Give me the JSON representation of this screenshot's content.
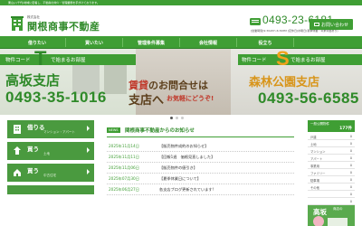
{
  "topbar": {
    "text": "栗山(八千代)地域に密着し、不動産の仲介・管理業務を手がけております。"
  },
  "header": {
    "logo_small": "株式会社",
    "company_name": "関根商事不動産",
    "phone": "0493-23-6181",
    "info": "[営業時間]9:30AM〜6:30PM [定休日]水曜日(夏季休業・年末年始あり)",
    "contact_label": "お問い合わせ"
  },
  "nav": {
    "items": [
      {
        "label": "借りたい"
      },
      {
        "label": "買いたい"
      },
      {
        "label": "管理条件募集"
      },
      {
        "label": "会社情報"
      },
      {
        "label": "役立ち"
      },
      {
        "label": ""
      }
    ]
  },
  "slider": {
    "left": {
      "code_prefix": "物件コード",
      "code_letter": "T",
      "code_suffix": "で始まるお部屋",
      "shop": "高坂支店",
      "phone": "0493-35-1016"
    },
    "center": {
      "line1_red": "賃貸",
      "line1": "のお問合せは",
      "line2": "支店へ",
      "line2_small": "お気軽にどうぞ!"
    },
    "right": {
      "code_prefix": "物件コード",
      "code_letter": "S",
      "code_suffix": "で始まるお部屋",
      "shop": "森林公園支店",
      "phone": "0493-56-6585"
    },
    "slide_count": 3
  },
  "sidemenu": [
    {
      "title": "借りる",
      "sub": "マンション・アパート"
    },
    {
      "title": "買う",
      "sub": "土地"
    },
    {
      "title": "買う",
      "sub": "中古住宅"
    },
    {
      "title": "",
      "sub": ""
    }
  ],
  "news": {
    "badge": "NEWS",
    "title": "関根商事不動産からのお知らせ",
    "items": [
      {
        "date": "2025年11月14日",
        "text": "【販売物件成約のお知らせ】"
      },
      {
        "date": "2025年11月11日",
        "text": "【回報1週　価格見直しました】"
      },
      {
        "date": "2025年11月06日",
        "text": "【販売物件の値引き】"
      },
      {
        "date": "2025年07月30日",
        "text": "【夏季休業日について】"
      },
      {
        "date": "2025年06月27日",
        "text": "各支店ブログ更新されています!"
      }
    ]
  },
  "right_panel": {
    "title": "一般公開物件",
    "total": "177件",
    "rows": [
      {
        "name": "戸建",
        "count": "0"
      },
      {
        "name": "土地",
        "count": "0"
      },
      {
        "name": "マンション",
        "count": "0"
      },
      {
        "name": "アパート",
        "count": "0"
      },
      {
        "name": "事業用",
        "count": "0"
      },
      {
        "name": "ファミリー",
        "count": "0"
      },
      {
        "name": "駐車場",
        "count": "0"
      },
      {
        "name": "その他",
        "count": "0"
      },
      {
        "name": "",
        "count": "0"
      },
      {
        "name": "",
        "count": "0"
      }
    ],
    "banner_text": "高坂",
    "banner_sub": "商店の"
  },
  "colors": {
    "brand_green": "#3f9e34",
    "text_green": "#2f8a29",
    "accent_red": "#c0392b"
  }
}
